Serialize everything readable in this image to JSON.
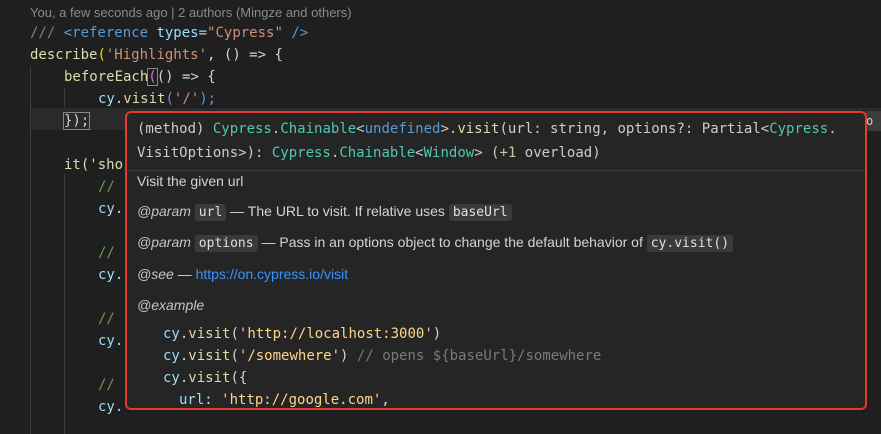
{
  "codelens": "You, a few seconds ago | 2 authors (Mingze and others)",
  "code": {
    "l1_prefix": "/// ",
    "l1_tag": "<reference",
    "l1_attr": " types=",
    "l1_val": "\"Cypress\"",
    "l1_close": " />",
    "l2_fn": "describe",
    "l2_open": "(",
    "l2_str": "'Highlights'",
    "l2_rest": ", () => {",
    "l3_fn": "beforeEach",
    "l3_open": "(",
    "l3_rest": "() => {",
    "l4_obj": "cy",
    "l4_dot": ".",
    "l4_fn": "visit",
    "l4_open": "(",
    "l4_str": "'/'",
    "l4_close": ");",
    "l5": "});",
    "it_frag": "it('sho",
    "comment": "//",
    "cy": "cy."
  },
  "hover": {
    "sig_line1": {
      "prefix": "(method) ",
      "cls1": "Cypress",
      "dot1": ".",
      "cls2": "Chainable",
      "lt1": "<",
      "kw1": "undefined",
      "gt1": ">.",
      "fn": "visit",
      "params": "(url: string, options?: Partial<",
      "cls3": "Cypress",
      "dot2": "."
    },
    "sig_line2": {
      "part1": "VisitOptions>): ",
      "cls1": "Cypress",
      "dot": ".",
      "cls2": "Chainable",
      "lt": "<",
      "cls3": "Window",
      "gt": "> (",
      "num": "+1",
      "tail": " overload)"
    },
    "summary": "Visit the given url",
    "param1_tag": "@param",
    "param1_name": "url",
    "param1_desc": " — The URL to visit. If relative uses ",
    "param1_chip": "baseUrl",
    "param2_tag": "@param",
    "param2_name": "options",
    "param2_desc": " — Pass in an options object to change the default behavior of ",
    "param2_chip": "cy.visit()",
    "see_tag": "@see",
    "see_dash": " — ",
    "see_link": "https://on.cypress.io/visit",
    "example_tag": "@example",
    "ex1": {
      "obj": "cy",
      "dot": ".",
      "fn": "visit",
      "open": "(",
      "str": "'http://localhost:3000'",
      "close": ")"
    },
    "ex2": {
      "obj": "cy",
      "dot": ".",
      "fn": "visit",
      "open": "(",
      "str": "'/somewhere'",
      "close": ")",
      "comment": " // opens ${baseUrl}/somewhere"
    },
    "ex3": {
      "obj": "cy",
      "dot": ".",
      "fn": "visit",
      "open": "({"
    },
    "ex4": {
      "key": "url",
      "colon": ": ",
      "str": "'http://google.com'",
      "comma": ","
    }
  },
  "right_hint": "o"
}
